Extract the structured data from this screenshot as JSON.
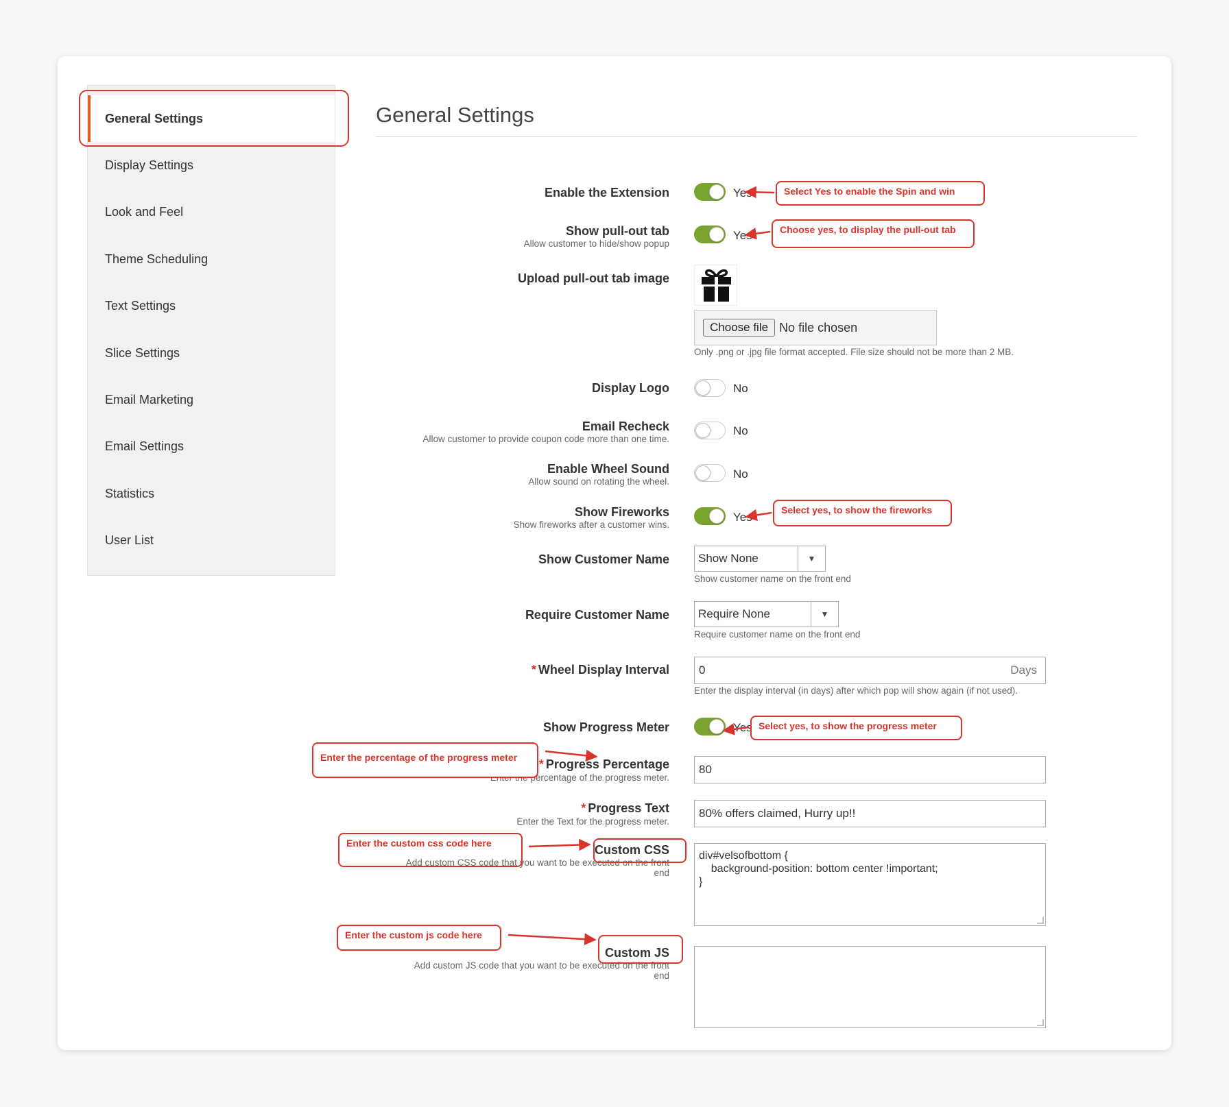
{
  "sidebar": {
    "items": [
      {
        "label": "General Settings",
        "active": true
      },
      {
        "label": "Display Settings"
      },
      {
        "label": "Look and Feel"
      },
      {
        "label": "Theme Scheduling"
      },
      {
        "label": "Text Settings"
      },
      {
        "label": "Slice Settings"
      },
      {
        "label": "Email Marketing"
      },
      {
        "label": "Email Settings"
      },
      {
        "label": "Statistics"
      },
      {
        "label": "User List"
      }
    ]
  },
  "page": {
    "title": "General Settings"
  },
  "fields": {
    "enable_extension": {
      "label": "Enable the Extension",
      "state": "Yes"
    },
    "pullout_tab": {
      "label": "Show pull-out tab",
      "sub": "Allow customer to hide/show popup",
      "state": "Yes"
    },
    "pullout_image": {
      "label": "Upload pull-out tab image",
      "button": "Choose file",
      "file": "No file chosen",
      "note": "Only .png or .jpg file format accepted. File size should not be more than 2 MB."
    },
    "display_logo": {
      "label": "Display Logo",
      "state": "No"
    },
    "email_recheck": {
      "label": "Email Recheck",
      "sub": "Allow customer to provide coupon code more than one time.",
      "state": "No"
    },
    "wheel_sound": {
      "label": "Enable Wheel Sound",
      "sub": "Allow sound on rotating the wheel.",
      "state": "No"
    },
    "fireworks": {
      "label": "Show Fireworks",
      "sub": "Show fireworks after a customer wins.",
      "state": "Yes"
    },
    "show_customer_name": {
      "label": "Show Customer Name",
      "value": "Show None",
      "note": "Show customer name on the front end"
    },
    "require_customer_name": {
      "label": "Require Customer Name",
      "value": "Require None",
      "note": "Require customer name on the front end"
    },
    "wheel_interval": {
      "required": "*",
      "label": "Wheel Display Interval",
      "value": "0",
      "suffix": "Days",
      "note": "Enter the display interval (in days) after which pop will show again (if not used)."
    },
    "progress_meter": {
      "label": "Show Progress Meter",
      "state": "Yes"
    },
    "progress_percentage": {
      "required": "*",
      "label": "Progress Percentage",
      "sub": "Enter the percentage of the progress meter.",
      "value": "80"
    },
    "progress_text": {
      "required": "*",
      "label": "Progress Text",
      "sub": "Enter the Text for the progress meter.",
      "value": "80% offers claimed, Hurry up!!"
    },
    "custom_css": {
      "label": "Custom CSS",
      "sub1": "Add custom CSS code that you want to be executed on the front",
      "sub2": "end",
      "value": "div#velsofbottom {\n    background-position: bottom center !important;\n}"
    },
    "custom_js": {
      "label": "Custom JS",
      "sub1": "Add custom JS code that you want to be executed on the front",
      "sub2": "end",
      "value": ""
    }
  },
  "annotations": {
    "enable": "Select Yes to enable the Spin and win",
    "pullout": "Choose yes, to display the pull-out tab",
    "fireworks": "Select yes, to show the fireworks",
    "progress_meter": "Select yes, to show the progress meter",
    "progress_percentage": "Enter the percentage of the progress meter",
    "custom_css": "Enter the custom css code here",
    "custom_js": "Enter the custom js code here"
  },
  "colors": {
    "accent": "#e85d1d",
    "toggle_on": "#79a22e",
    "annotation": "#d9342b"
  },
  "icons": {
    "pullout_image": "gift-icon",
    "select_arrow": "caret-down-icon"
  }
}
